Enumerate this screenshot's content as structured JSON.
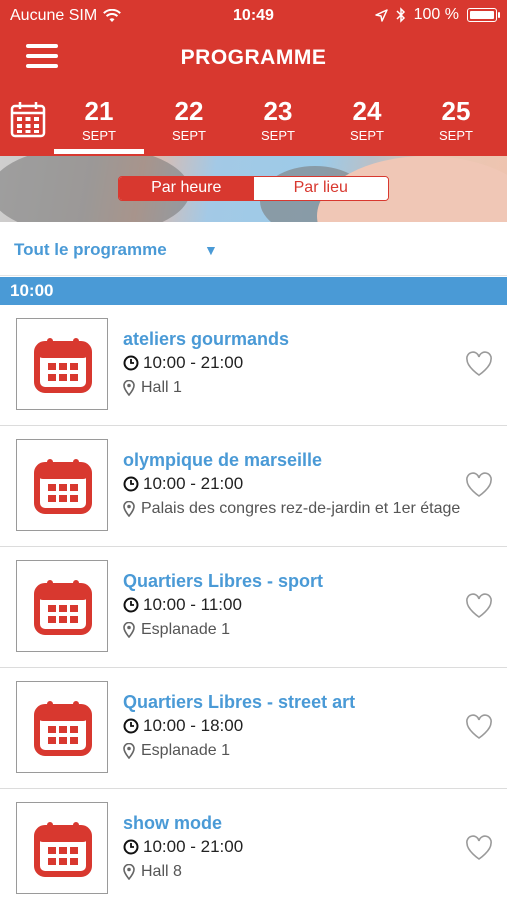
{
  "status_bar": {
    "carrier": "Aucune SIM",
    "time": "10:49",
    "battery": "100 %"
  },
  "header": {
    "title": "PROGRAMME"
  },
  "days": [
    {
      "num": "21",
      "month": "SEPT",
      "active": true
    },
    {
      "num": "22",
      "month": "SEPT",
      "active": false
    },
    {
      "num": "23",
      "month": "SEPT",
      "active": false
    },
    {
      "num": "24",
      "month": "SEPT",
      "active": false
    },
    {
      "num": "25",
      "month": "SEPT",
      "active": false
    }
  ],
  "view_toggle": {
    "by_hour": "Par heure",
    "by_place": "Par lieu",
    "selected": "Par heure"
  },
  "filter": {
    "label": "Tout le programme"
  },
  "hour_section": "10:00",
  "events": [
    {
      "title": "ateliers gourmands",
      "time": "10:00 - 21:00",
      "place": "Hall 1"
    },
    {
      "title": "olympique de marseille",
      "time": "10:00 - 21:00",
      "place": "Palais des congres rez-de-jardin et 1er étage"
    },
    {
      "title": "Quartiers Libres - sport",
      "time": "10:00 - 11:00",
      "place": "Esplanade 1"
    },
    {
      "title": "Quartiers Libres - street art",
      "time": "10:00 - 18:00",
      "place": "Esplanade 1"
    },
    {
      "title": "show mode",
      "time": "10:00 - 21:00",
      "place": "Hall 8"
    }
  ],
  "colors": {
    "brand_red": "#d8382f",
    "accent_blue": "#4a9ad6"
  },
  "icons": {
    "menu": "hamburger-icon",
    "calendar": "calendar-icon",
    "clock": "clock-icon",
    "pin": "location-pin-icon",
    "favorite": "heart-outline-icon"
  }
}
